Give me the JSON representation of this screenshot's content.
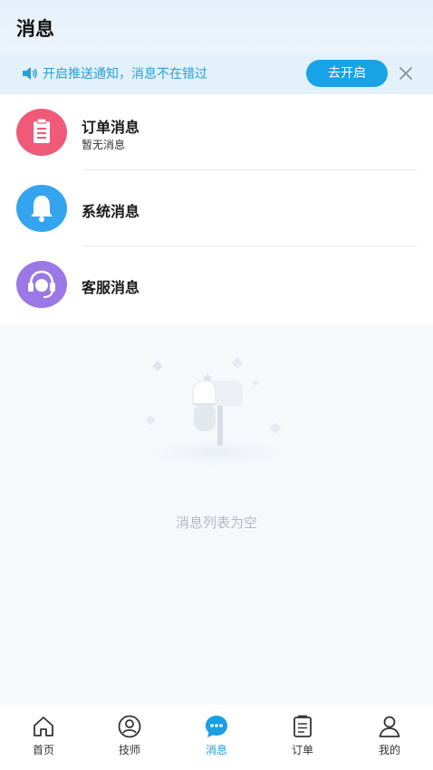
{
  "header": {
    "title": "消息"
  },
  "notice": {
    "text": "开启推送通知，消息不在错过",
    "open_button": "去开启",
    "speaker_icon": "speaker-icon",
    "close_icon": "close-icon"
  },
  "messages": [
    {
      "title": "订单消息",
      "subtitle": "暂无消息",
      "icon": "clipboard-icon",
      "color": "#ef5a78"
    },
    {
      "title": "系统消息",
      "subtitle": "",
      "icon": "bell-icon",
      "color": "#35a4ef"
    },
    {
      "title": "客服消息",
      "subtitle": "",
      "icon": "headset-icon",
      "color": "#9a78e6"
    }
  ],
  "empty": {
    "text": "消息列表为空",
    "illustration": "mailbox-illustration"
  },
  "tabbar": {
    "items": [
      {
        "label": "首页",
        "icon": "home-icon",
        "active": false
      },
      {
        "label": "技师",
        "icon": "technician-icon",
        "active": false
      },
      {
        "label": "消息",
        "icon": "message-icon",
        "active": true
      },
      {
        "label": "订单",
        "icon": "order-icon",
        "active": false
      },
      {
        "label": "我的",
        "icon": "profile-icon",
        "active": false
      }
    ]
  },
  "colors": {
    "accent": "#1a9ee4",
    "notice_bg": "#e3f1fb",
    "notice_text": "#2a9fd6"
  }
}
